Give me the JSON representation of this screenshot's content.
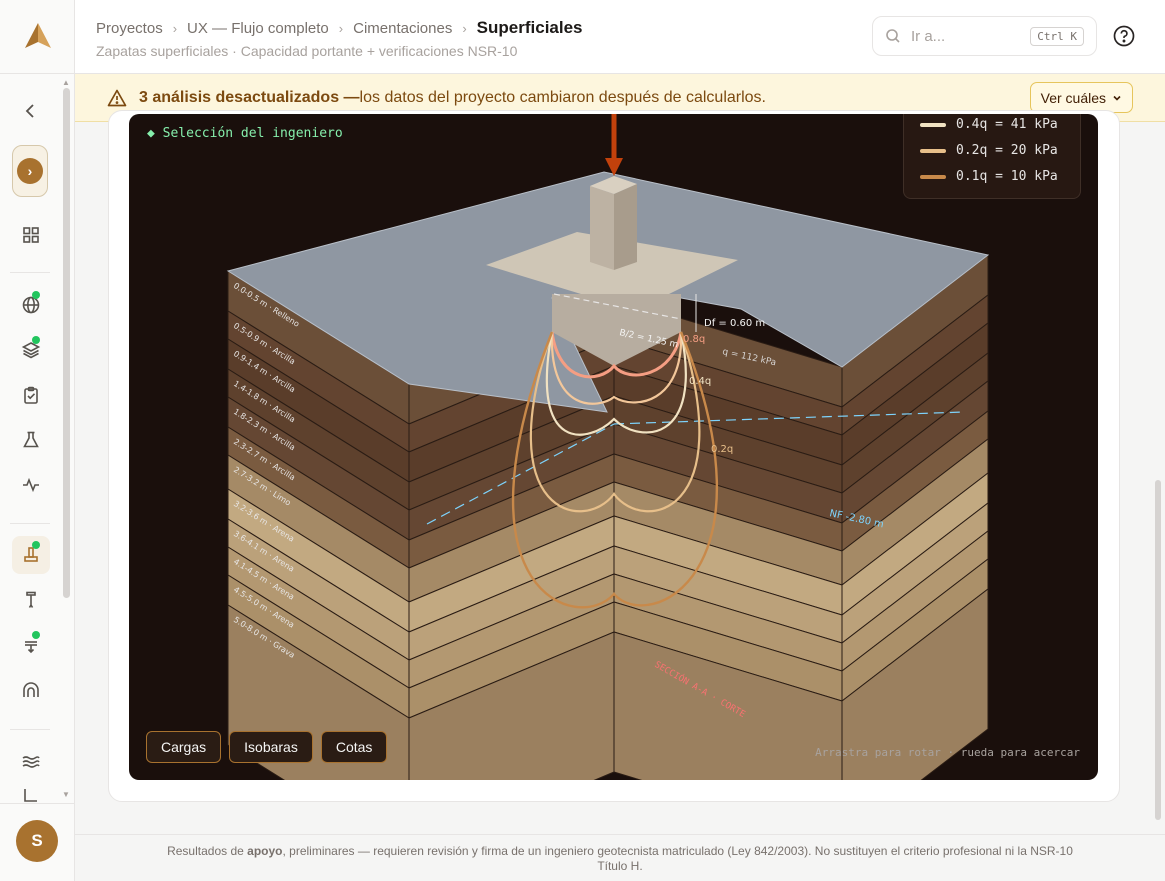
{
  "breadcrumb": {
    "items": [
      "Proyectos",
      "UX — Flujo completo",
      "Cimentaciones"
    ],
    "current": "Superficiales"
  },
  "header": {
    "subtitle": "Zapatas superficiales · Capacidad portante + verificaciones NSR-10",
    "search_placeholder": "Ir a...",
    "search_shortcut": "Ctrl K"
  },
  "banner": {
    "bold_text": "3 análisis desactualizados —",
    "text": " los datos del proyecto cambiaron después de calcularlos.",
    "button_label": "Ver cuáles"
  },
  "user": {
    "initial": "S"
  },
  "viewer": {
    "selection_label": "Selección del ingeniero",
    "legend": [
      {
        "label": "0.4q = 41 kPa",
        "color": "#f1e2c2"
      },
      {
        "label": "0.2q = 20 kPa",
        "color": "#e7bf8a"
      },
      {
        "label": "0.1q = 10 kPa",
        "color": "#c8894a"
      }
    ],
    "buttons": [
      "Cargas",
      "Isobaras",
      "Cotas"
    ],
    "hint": "Arrastra para rotar · rueda para acercar",
    "annotations": {
      "df": "Df = 0.60 m",
      "b2": "B/2 = 1.25 m",
      "q": "q = 112 kPa",
      "iso_08": "0.8q",
      "iso_04": "0.4q",
      "iso_02": "0.2q",
      "nf": "NF -2.80 m",
      "seccion": "SECCIÓN A-A · CORTE"
    },
    "strata": [
      "0.0-0.5 m · Relleno",
      "0.5-0.9 m · Arcilla",
      "0.9-1.4 m · Arcilla",
      "1.4-1.8 m · Arcilla",
      "1.8-2.3 m · Arcilla",
      "2.3-2.7 m · Arcilla",
      "2.7-3.2 m · Limo",
      "3.2-3.6 m · Arena",
      "3.6-4.1 m · Arena",
      "4.1-4.5 m · Arena",
      "4.5-5.0 m · Arena",
      "5.0-8.0 m · Grava"
    ]
  },
  "footer": {
    "text_a": "Resultados de ",
    "text_bold": "apoyo",
    "text_b": ", preliminares — requieren revisión y firma de un ingeniero geotecnista matriculado (Ley 842/2003). No sustituyen el criterio profesional ni la NSR-10",
    "text_c": "Título H."
  }
}
